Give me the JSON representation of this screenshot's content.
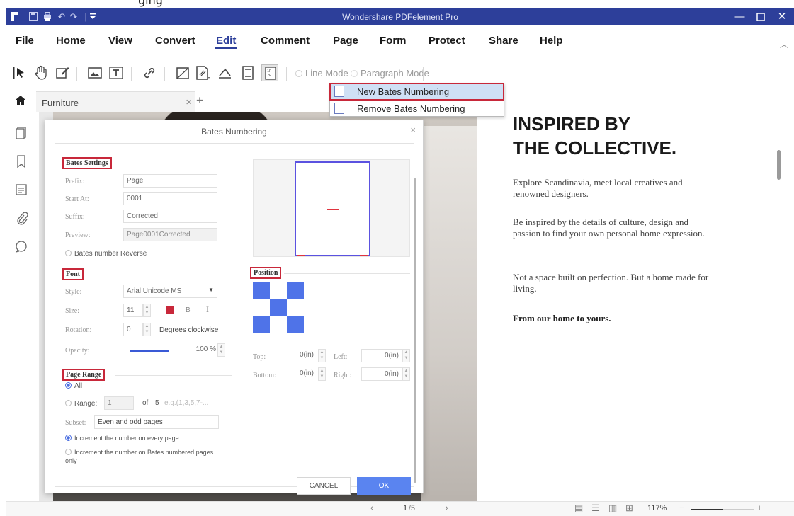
{
  "top_strip": "ging",
  "window": {
    "title": "Wondershare PDFelement Pro"
  },
  "menu": {
    "items": [
      "File",
      "Home",
      "View",
      "Convert",
      "Edit",
      "Comment",
      "Page",
      "Form",
      "Protect",
      "Share",
      "Help"
    ],
    "active": "Edit"
  },
  "toolbar": {
    "line_mode": "Line Mode",
    "paragraph_mode": "Paragraph Mode"
  },
  "tab": {
    "label": "Furniture",
    "close": "×",
    "add": "+"
  },
  "dropdown": {
    "new_bates": "New Bates Numbering",
    "remove_bates": "Remove Bates Numbering"
  },
  "dialog": {
    "title": "Bates Numbering",
    "close": "×",
    "bates_settings": {
      "heading": "Bates Settings",
      "prefix_label": "Prefix:",
      "prefix": "Page",
      "start_label": "Start At:",
      "start": "0001",
      "suffix_label": "Suffix:",
      "suffix": "Corrected",
      "preview_label": "Preview:",
      "preview": "Page0001Corrected",
      "reverse_label": "Bates number Reverse"
    },
    "font": {
      "heading": "Font",
      "style_label": "Style:",
      "style": "Arial Unicode MS",
      "size_label": "Size:",
      "size": "11",
      "bold": "B",
      "italic": "I",
      "color": "#c8283a",
      "rotation_label": "Rotation:",
      "rotation": "0",
      "rotation_unit": "Degrees clockwise",
      "opacity_label": "Opacity:",
      "opacity": "100 %"
    },
    "position": {
      "heading": "Position",
      "top_label": "Top:",
      "top": "0(in)",
      "left_label": "Left:",
      "left": "0(in)",
      "bottom_label": "Bottom:",
      "bottom": "0(in)",
      "right_label": "Right:",
      "right": "0(in)"
    },
    "page_range": {
      "heading": "Page Range",
      "all_label": "All",
      "range_label": "Range:",
      "range_value": "1",
      "of_label": "of",
      "total": "5",
      "example": "e.g.(1,3,5,7-...",
      "subset_label": "Subset:",
      "subset": "Even and odd pages",
      "increment_every": "Increment the number on every page",
      "increment_bates": "Increment the number on Bates numbered pages only"
    },
    "cancel": "CANCEL",
    "ok": "OK"
  },
  "document": {
    "heading_line1": "INSPIRED BY",
    "heading_line2": "THE COLLECTIVE.",
    "para1": "Explore Scandinavia, meet local creatives and renowned designers.",
    "para2": "Be inspired by the details of culture, design and passion to find your own personal home expression.",
    "para3": "Not a space built on perfection. But a home made for living.",
    "para4": "From our home to yours."
  },
  "status": {
    "page": "1",
    "page_total": "/5",
    "zoom": "117%"
  },
  "colors": {
    "title_bar": "#2d3f9a",
    "accent": "#5a84f0",
    "highlight_box": "#c8283a"
  }
}
